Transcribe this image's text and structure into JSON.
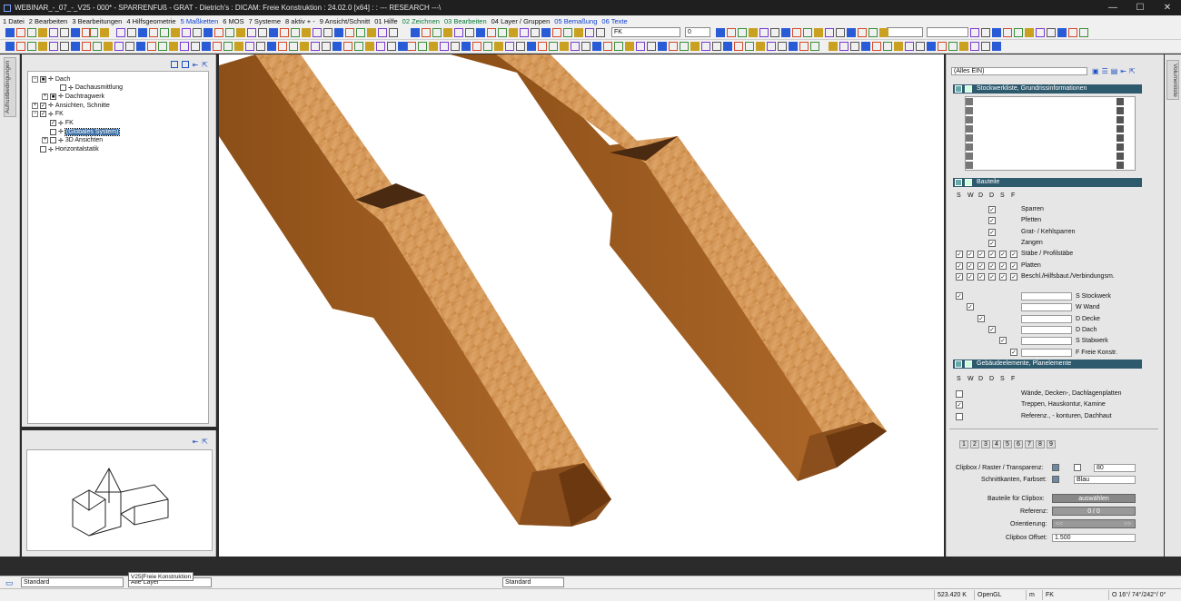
{
  "window": {
    "title": "WEBINAR_-_07_-_V25 - 000* - SPARRENFUß - GRAT - Dietrich's : DICAM: Freie Konstruktion : 24.02.0 [x64] : : --- RESEARCH ---\\",
    "minimize": "—",
    "maximize": "☐",
    "close": "✕"
  },
  "menu": [
    {
      "label": "1 Datei",
      "color": ""
    },
    {
      "label": "2 Bearbeiten",
      "color": ""
    },
    {
      "label": "3 Bearbeitungen",
      "color": ""
    },
    {
      "label": "4 Hilfsgeometrie",
      "color": ""
    },
    {
      "label": "5 Maßketten",
      "color": "b"
    },
    {
      "label": "6 MOS",
      "color": ""
    },
    {
      "label": "7 Systeme",
      "color": ""
    },
    {
      "label": "8 aktiv + -",
      "color": ""
    },
    {
      "label": "9 Ansicht/Schnitt",
      "color": ""
    },
    {
      "label": "01 Hilfe",
      "color": ""
    },
    {
      "label": "02 Zeichnen",
      "color": "g"
    },
    {
      "label": "03 Bearbeiten",
      "color": "g"
    },
    {
      "label": "04 Layer / Gruppen",
      "color": ""
    },
    {
      "label": "05 Bemaßung",
      "color": "b"
    },
    {
      "label": "06 Texte",
      "color": "b"
    }
  ],
  "toolbar": {
    "layer_field": "FK",
    "number_field": "0"
  },
  "left_tab": "Aufrustbedingungen",
  "right_tab": "Volumenliste",
  "tree": [
    {
      "label": "Dach",
      "level": 0,
      "pm": "−",
      "checked": "■"
    },
    {
      "label": "Dachausmittlung",
      "level": 2,
      "pm": "",
      "checked": ""
    },
    {
      "label": "Dachtragwerk",
      "level": 1,
      "pm": "+",
      "checked": "■"
    },
    {
      "label": "Ansichten, Schnitte",
      "level": 0,
      "pm": "+",
      "checked": "✓"
    },
    {
      "label": "FK",
      "level": 0,
      "pm": "−",
      "checked": "✓"
    },
    {
      "label": "FK",
      "level": 1,
      "pm": "",
      "checked": "✓"
    },
    {
      "label": "(Globales System)",
      "level": 1,
      "pm": "",
      "checked": "",
      "selected": true
    },
    {
      "label": "3D Ansichten",
      "level": 1,
      "pm": "+",
      "checked": ""
    },
    {
      "label": "Horizontalstatik",
      "level": 0,
      "pm": "",
      "checked": ""
    }
  ],
  "right": {
    "filter": "(Alles EIN)",
    "sections": [
      "Stockwerkliste, Grundrissinformationen",
      "Bauteile",
      "Gebäudeelemente, Planelemente"
    ],
    "col_headers": [
      "S",
      "W",
      "D",
      "D",
      "S",
      "F"
    ],
    "bauteile": [
      {
        "label": "Sparren",
        "checks": [
          0,
          0,
          0,
          1,
          0,
          0
        ]
      },
      {
        "label": "Pfetten",
        "checks": [
          0,
          0,
          0,
          1,
          0,
          0
        ]
      },
      {
        "label": "Grat- / Kehlsparren",
        "checks": [
          0,
          0,
          0,
          1,
          0,
          0
        ]
      },
      {
        "label": "Zangen",
        "checks": [
          0,
          0,
          0,
          1,
          0,
          0
        ]
      },
      {
        "label": "Stäbe / Profilstäbe",
        "checks": [
          1,
          1,
          1,
          1,
          1,
          1
        ]
      },
      {
        "label": "Platten",
        "checks": [
          1,
          1,
          1,
          1,
          1,
          1
        ]
      },
      {
        "label": "Beschl./Hilfsbaut./Verbindungsm.",
        "checks": [
          1,
          1,
          1,
          1,
          1,
          1
        ]
      }
    ],
    "stockwerke": [
      "S Stockwerk",
      "W Wand",
      "D Decke",
      "D Dach",
      "S Stabwerk",
      "F Freie Konstr."
    ],
    "gebaeude": [
      {
        "label": "Wände, Decken-, Dachlagenplatten",
        "s": ""
      },
      {
        "label": "Treppen, Hauskontur, Kamine",
        "s": "✓"
      },
      {
        "label": "Referenz., - konturen, Dachhaut",
        "s": ""
      }
    ],
    "tabs": [
      "1",
      "2",
      "3",
      "4",
      "5",
      "6",
      "7",
      "8",
      "9"
    ],
    "clip": {
      "row1_label": "Clipbox / Raster / Transparenz:",
      "row1_value": "80",
      "row2_label": "Schnittkanten, Farbset:",
      "row2_value": "Blau",
      "row3_label": "Bauteile für Clipbox:",
      "row3_button": "auswählen",
      "row4_label": "Referenz:",
      "row4_value": "0 / 0",
      "row5_label": "Orientierung:",
      "row6_label": "Clipbox Offset:",
      "row6_value": "1.500",
      "nav_left": "<<",
      "nav_right": ">>"
    }
  },
  "bottom": {
    "style_left": "Standard",
    "layer_select": "Alle Layer",
    "style_right": "Standard",
    "tooltip": "V25[Freie Konstruktion"
  },
  "status": {
    "memory": "523.420 K",
    "renderer": "OpenGL",
    "unit": "m",
    "layer": "FK",
    "angles": "O 16°/ 74°/242°/  0°"
  },
  "colors": {
    "wood_top": "#d79a55",
    "wood_side": "#9b5a1c",
    "panel_header": "#2e5a6e"
  }
}
